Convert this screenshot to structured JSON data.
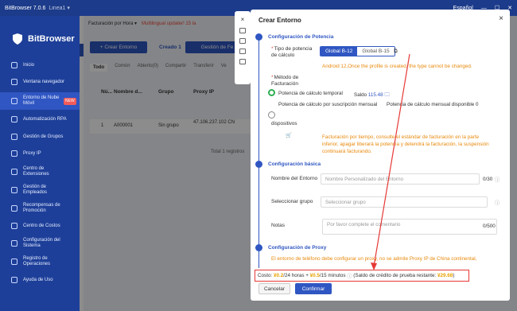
{
  "titlebar": {
    "app": "BitBrowser 7.0.6",
    "line": "Linea1 ▾",
    "language": "Español"
  },
  "sidebar": {
    "brand": "BitBrowser",
    "items": [
      {
        "label": "Inicio"
      },
      {
        "label": "Ventana navegador"
      },
      {
        "label": "Entorno de Nube Móvil",
        "badge": "NEW"
      },
      {
        "label": "Automatización RPA"
      },
      {
        "label": "Gestión de Grupos"
      },
      {
        "label": "Proxy IP"
      },
      {
        "label": "Centro de Extensiones"
      },
      {
        "label": "Gestión de Empleados"
      },
      {
        "label": "Recompensas de Promoción"
      },
      {
        "label": "Centro de Costos"
      },
      {
        "label": "Configuración del Sistema"
      },
      {
        "label": "Registro de Operaciones"
      },
      {
        "label": "Ayuda de Uso"
      }
    ]
  },
  "main": {
    "filter": "Facturación por Hora ▾",
    "update": "Multilingual updater! 15 la",
    "create_button": "+ Crear Entorno",
    "created": "Creado 1",
    "gestion_button": "Gestión de Fe",
    "tabs": [
      "Todo",
      "Común",
      "Abierto(0)",
      "Compartir",
      "Transferir",
      "Ve"
    ],
    "columns": [
      "Nú...",
      "Nombre d...",
      "Grupo",
      "Proxy IP"
    ],
    "row": {
      "num": "1",
      "name": "A000001",
      "group": "Sin grupo",
      "ip": "47.106.237.102 CN"
    },
    "total": "Total 1 registros"
  },
  "modal": {
    "title": "Crear Entorno",
    "close": "×",
    "sec_power": "Configuración de Potencia",
    "power_type_label": "Tipo de potencia de cálculo",
    "seg_a": "Global B-12",
    "seg_b": "Global B-15",
    "android_note": "Android 12,Once the profile is created, the type cannot be changed.",
    "billing_label": "Método de Facturación",
    "temp_power": "Potencia de cálculo temporal",
    "saldo_label": "Saldo",
    "saldo_value": "115.48",
    "monthly_sub": "Potencia de cálculo por suscripción mensual",
    "monthly_avail": "Potencia de cálculo mensual disponible 0",
    "dispositivos": "dispositivos",
    "billing_note": "Facturación por tiempo, consulte el estándar de facturación en la parte inferior, apagar liberará la potencia y detendrá la facturación, la suspensión continuará facturando.",
    "sec_basic": "Configuración básica",
    "env_name_label": "Nombre del Entorno",
    "env_name_placeholder": "Nombre Personalizado del Entorno",
    "env_name_count": "0/30",
    "group_label": "Seleccionar grupo",
    "group_placeholder": "Seleccionar grupo",
    "notes_label": "Notas",
    "notes_placeholder": "Por favor complete el comentario",
    "notes_count": "0/500",
    "sec_proxy": "Configuración de Proxy",
    "proxy_note": "El entorno de teléfono debe configurar un proxy, no se admite Proxy IP de China continental,",
    "cost_label": "Costo:",
    "cost_a": "¥0.2",
    "cost_a_unit": "/24 horas +",
    "cost_b": "¥0.5",
    "cost_b_unit": "/15 minutos",
    "credit_note": "(Saldo de crédito de prueba restante:",
    "credit_value": "¥29.68",
    "credit_close": ")",
    "cancel": "Cancelar",
    "confirm": "Confirmar"
  }
}
